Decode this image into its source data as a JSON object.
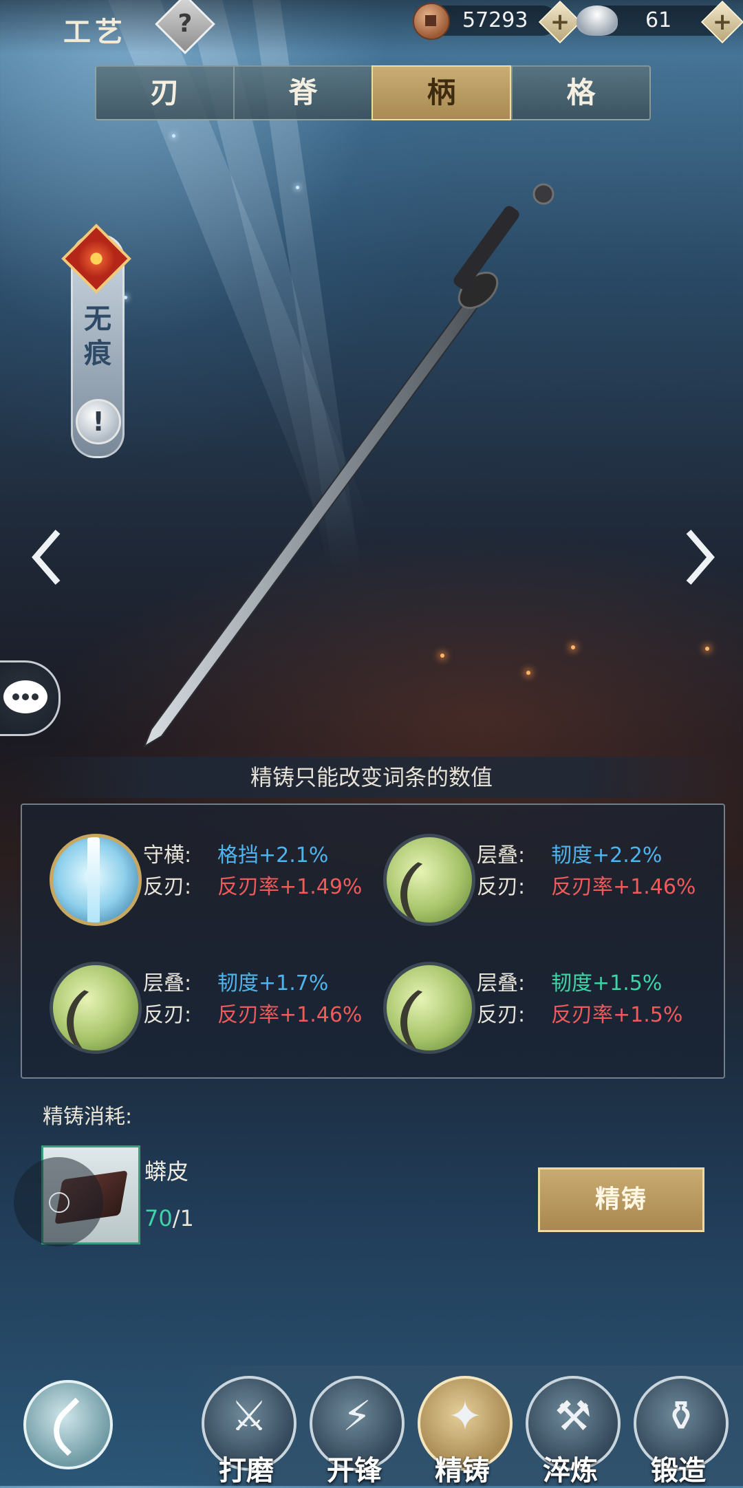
{
  "header": {
    "title": "工艺",
    "help_icon": "?",
    "currency": [
      {
        "icon": "copper-coin-icon",
        "amount": "57293"
      },
      {
        "icon": "silver-ingot-icon",
        "amount": "61"
      }
    ],
    "plus_label": "+"
  },
  "tabs": [
    {
      "label": "刃",
      "active": false
    },
    {
      "label": "脊",
      "active": false
    },
    {
      "label": "柄",
      "active": true
    },
    {
      "label": "格",
      "active": false
    }
  ],
  "weapon": {
    "name": "无痕",
    "alert": "!"
  },
  "hint": "精铸只能改变词条的数值",
  "attributes": [
    {
      "orb": "ice",
      "line1_label": "守横:",
      "line1_value": "格挡+2.1%",
      "line1_color": "#4fb4ee",
      "line2_label": "反刃:",
      "line2_value": "反刃率+1.49%",
      "line2_color": "#ef5b5b"
    },
    {
      "orb": "bamboo",
      "line1_label": "层叠:",
      "line1_value": "韧度+2.2%",
      "line1_color": "#4fb4ee",
      "line2_label": "反刃:",
      "line2_value": "反刃率+1.46%",
      "line2_color": "#ef5b5b"
    },
    {
      "orb": "bamboo",
      "line1_label": "层叠:",
      "line1_value": "韧度+1.7%",
      "line1_color": "#4fb4ee",
      "line2_label": "反刃:",
      "line2_value": "反刃率+1.46%",
      "line2_color": "#ef5b5b"
    },
    {
      "orb": "bamboo",
      "line1_label": "层叠:",
      "line1_value": "韧度+1.5%",
      "line1_color": "#3fd3a6",
      "line2_label": "反刃:",
      "line2_value": "反刃率+1.5%",
      "line2_color": "#ef5b5b"
    }
  ],
  "cost": {
    "label": "精铸消耗:",
    "item_name": "蟒皮",
    "have": "70",
    "need": "/1",
    "button": "精铸"
  },
  "nav": [
    {
      "label": "打磨",
      "glyph": "⚔",
      "active": false
    },
    {
      "label": "开锋",
      "glyph": "⚡",
      "active": false
    },
    {
      "label": "精铸",
      "glyph": "✦",
      "active": true
    },
    {
      "label": "淬炼",
      "glyph": "⚒",
      "active": false
    },
    {
      "label": "锻造",
      "glyph": "⚱",
      "active": false
    }
  ]
}
